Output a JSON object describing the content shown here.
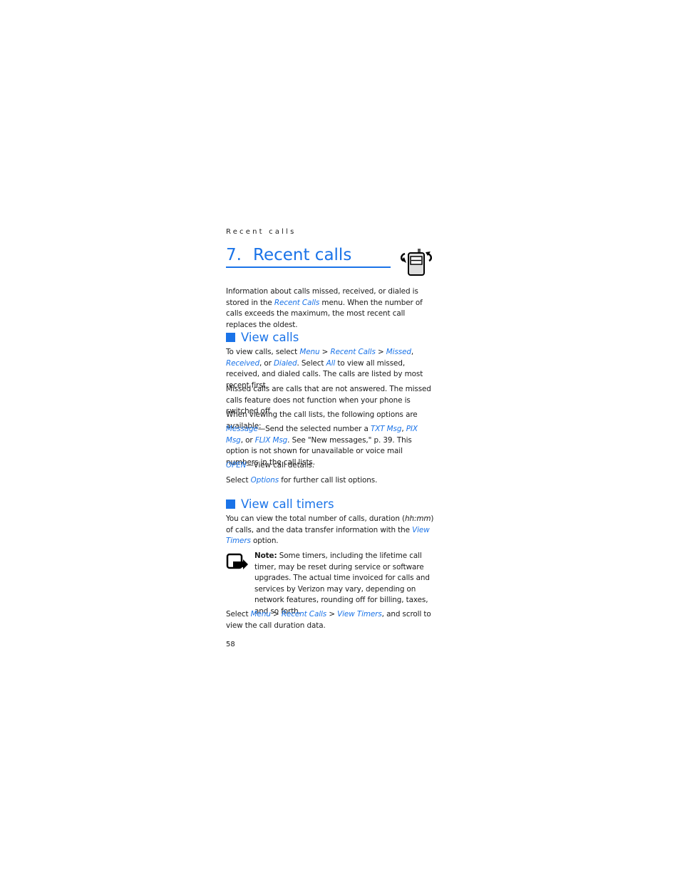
{
  "running_header": "Recent calls",
  "chapter": {
    "number": "7.",
    "title": "Recent calls",
    "icon": "phone-with-arrows-icon"
  },
  "intro": {
    "t1": "Information about calls missed, received, or dialed is stored in the ",
    "link1": "Recent Calls",
    "t2": " menu. When the number of calls exceeds the maximum, the most recent call replaces the oldest."
  },
  "section_view_calls": {
    "heading": "View calls",
    "p1": {
      "t1": "To view calls, select ",
      "menu": "Menu",
      "sep1": " > ",
      "recent": "Recent Calls",
      "sep2": " > ",
      "missed": "Missed",
      "comma1": ", ",
      "received": "Received",
      "t2": ", or ",
      "dialed": "Dialed",
      "t3": ". Select ",
      "all": "All",
      "t4": " to view all missed, received, and dialed calls. The calls are listed by most recent first."
    },
    "p2": "Missed calls are calls that are not answered. The missed calls feature does not function when your phone is switched off.",
    "p3": "When viewing the call lists, the following options are available:",
    "p4": {
      "message": "Message",
      "t1": "—Send the selected number a ",
      "txt": "TXT Msg",
      "comma": ", ",
      "pix": "PIX Msg",
      "t2": ", or ",
      "flix": "FLIX Msg",
      "t3": ". See \"New messages,\" p. 39. This option is not shown for unavailable or voice mail numbers in the call lists."
    },
    "p5": {
      "open": "OPEN",
      "t1": "—View call details."
    },
    "p6": {
      "t1": "Select ",
      "options": "Options",
      "t2": " for further call list options."
    }
  },
  "section_view_timers": {
    "heading": "View call timers",
    "p1": {
      "t1": "You can view the total number of calls, duration (",
      "hhmm": "hh:mm",
      "t2": ") of calls, and the data transfer information with the ",
      "link": "View Timers",
      "t3": " option."
    },
    "note": {
      "label": "Note:",
      "text": " Some timers, including the lifetime call timer, may be reset during service or software upgrades. The actual time invoiced for calls and services by Verizon may vary, depending on network features, rounding off for billing, taxes, and so forth.",
      "icon": "note-hand-icon"
    },
    "p2": {
      "t1": "Select ",
      "menu": "Menu",
      "sep1": " > ",
      "recent": "Recent Calls",
      "sep2": " > ",
      "timers": "View Timers",
      "t2": ", and scroll to view the call duration data."
    }
  },
  "page_number": "58",
  "colors": {
    "accent": "#1a73e8",
    "text": "#1a1a1a"
  }
}
